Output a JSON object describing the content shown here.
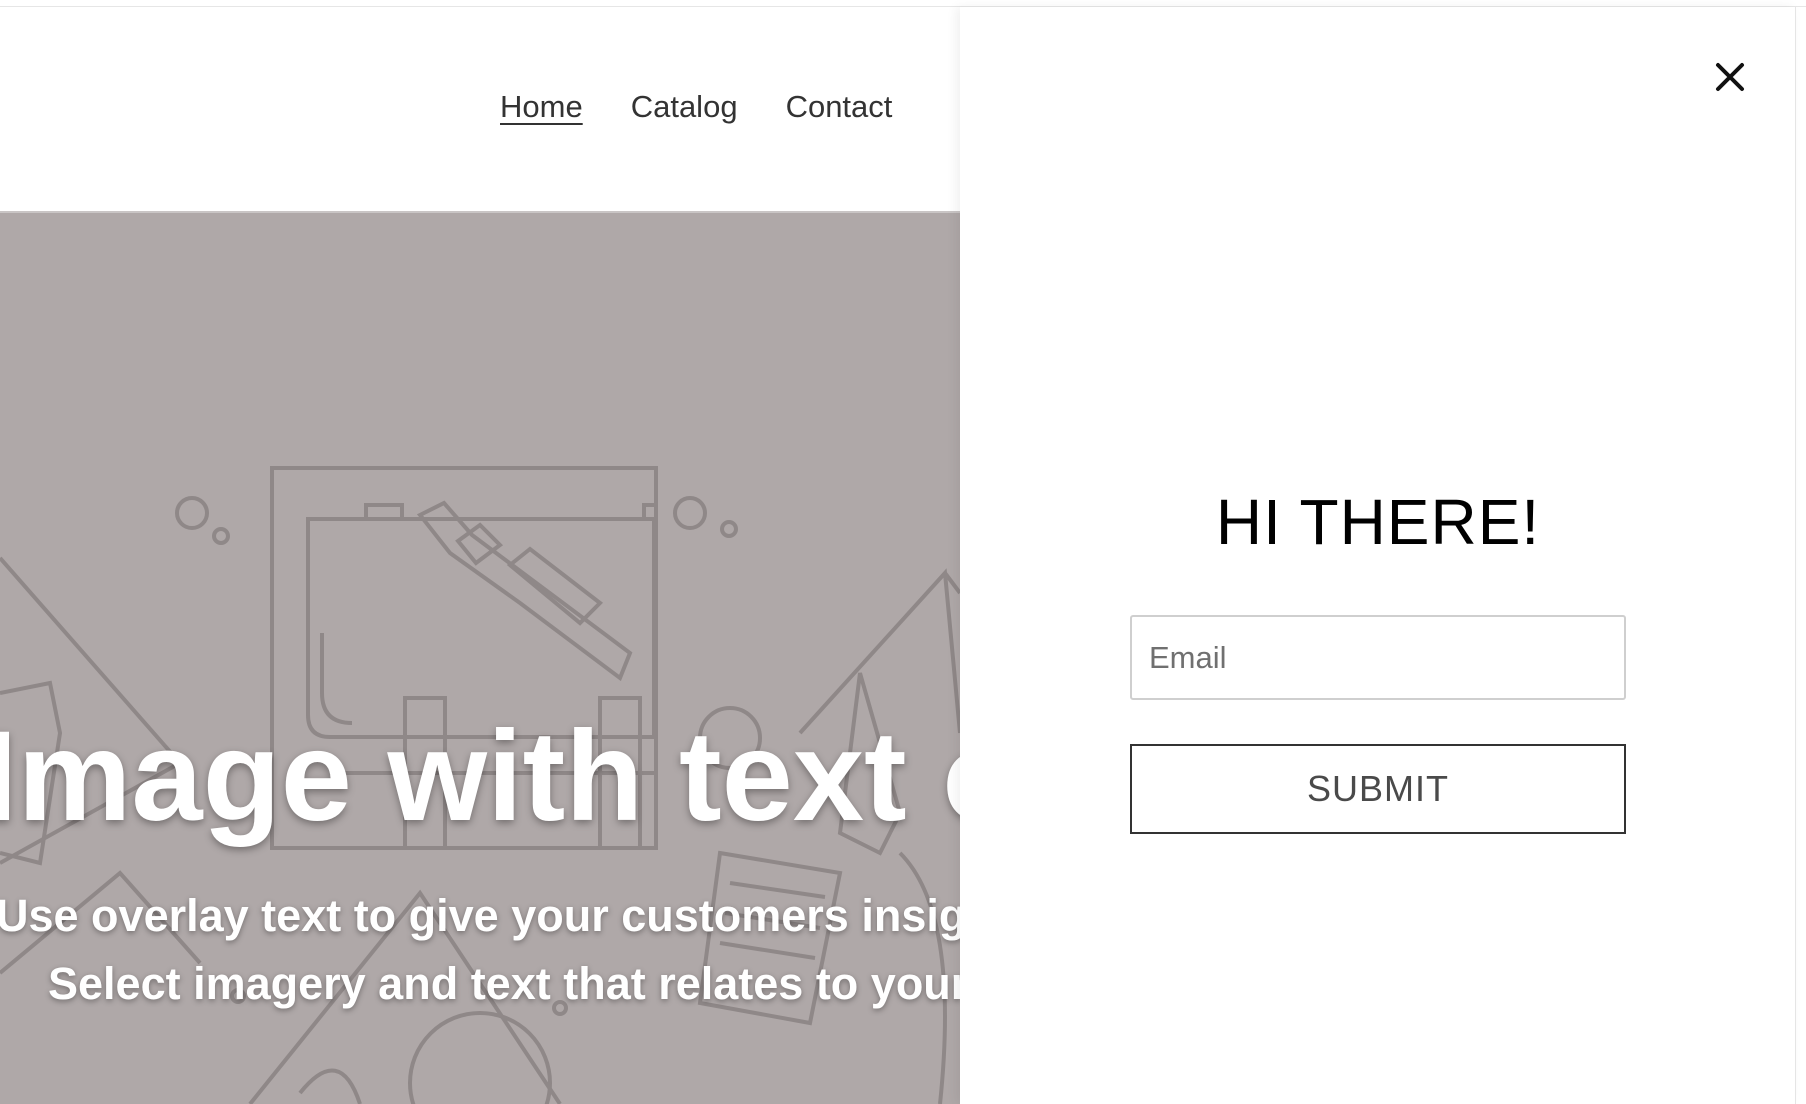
{
  "nav": {
    "items": [
      {
        "label": "Home",
        "active": true
      },
      {
        "label": "Catalog",
        "active": false
      },
      {
        "label": "Contact",
        "active": false
      }
    ]
  },
  "hero": {
    "title": "Image with text overlay",
    "subtitle_line1": "Use overlay text to give your customers insight into your brand.",
    "subtitle_line2": "Select imagery and text that relates to your style and story.",
    "background_color": "#afa8a8"
  },
  "drawer": {
    "close_icon": "close-icon",
    "title": "HI THERE!",
    "email_placeholder": "Email",
    "submit_label": "SUBMIT"
  }
}
